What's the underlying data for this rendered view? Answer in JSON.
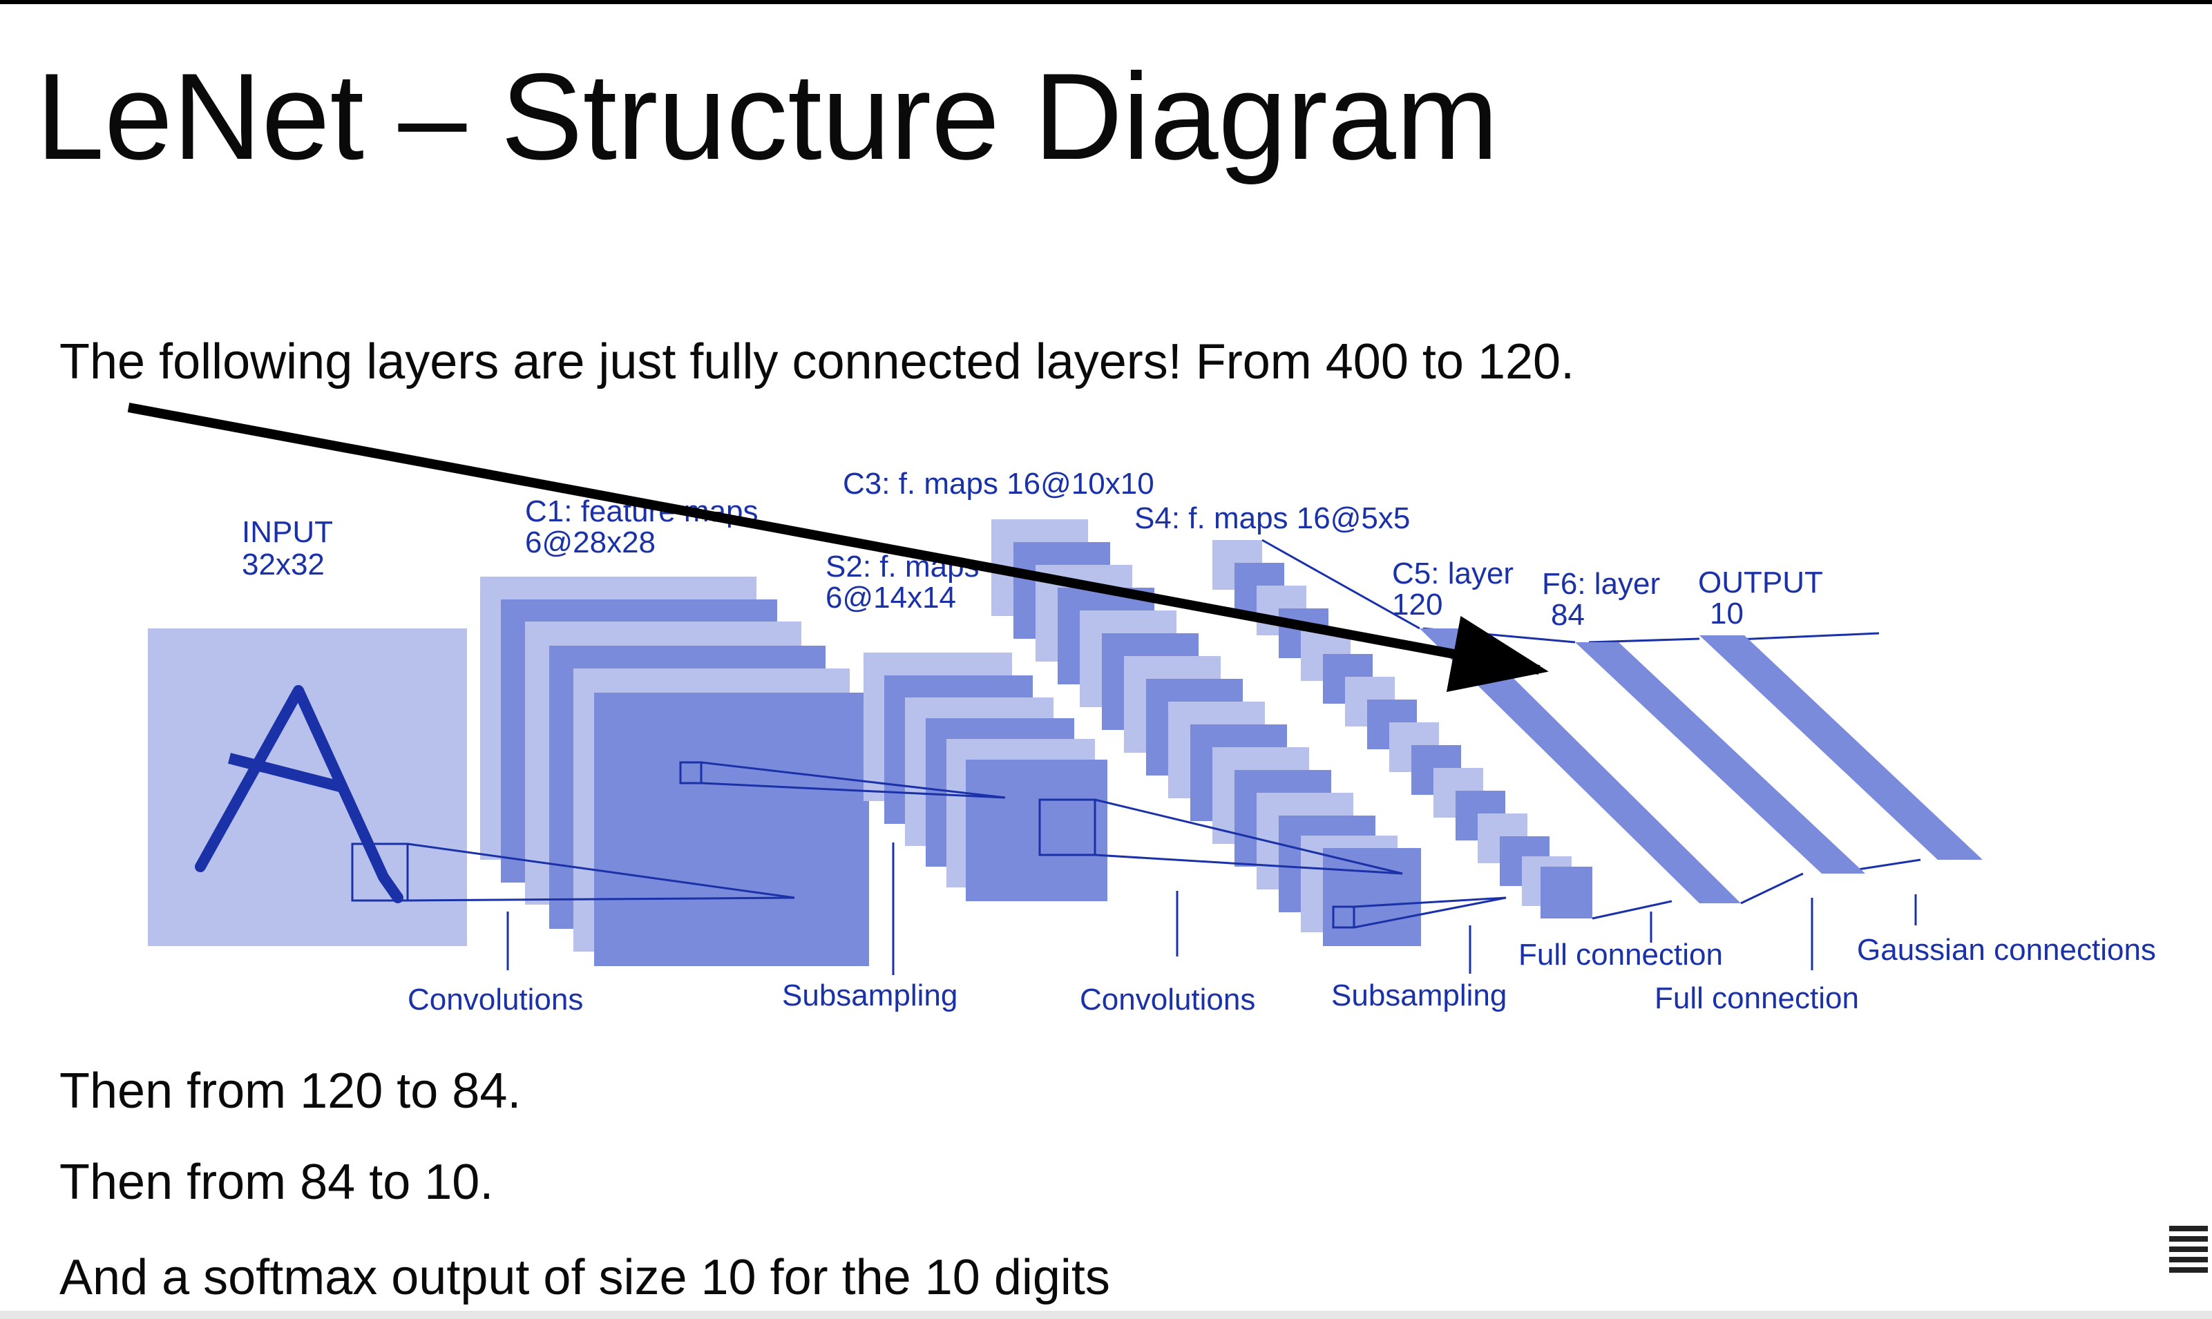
{
  "slide": {
    "title": "LeNet – Structure Diagram",
    "line1": "The following layers are just fully connected layers!  From 400 to 120.",
    "line2": "Then from 120 to 84.",
    "line3": "Then from 84 to 10.",
    "line4": "And a softmax output of size 10 for the 10 digits"
  },
  "diagram": {
    "input": {
      "title": "INPUT",
      "size": "32x32"
    },
    "c1": {
      "title": "C1: feature maps",
      "size": "6@28x28"
    },
    "s2": {
      "title": "S2: f. maps",
      "size": "6@14x14"
    },
    "c3": {
      "title": "C3: f. maps 16@10x10"
    },
    "s4": {
      "title": "S4: f. maps 16@5x5"
    },
    "c5": {
      "title": "C5: layer",
      "size": "120"
    },
    "f6": {
      "title": "F6: layer",
      "size": "84"
    },
    "output": {
      "title": "OUTPUT",
      "size": "10"
    },
    "ops": {
      "conv1": "Convolutions",
      "sub1": "Subsampling",
      "conv2": "Convolutions",
      "sub2": "Subsampling",
      "full1": "Full connection",
      "full2": "Full connection",
      "gauss": "Gaussian connections"
    }
  },
  "colors": {
    "light": "#b7c1eb",
    "mid": "#8c9be0",
    "dark": "#7b8bdb",
    "stroke": "#1a31a8",
    "text": "#0a0a0a"
  }
}
